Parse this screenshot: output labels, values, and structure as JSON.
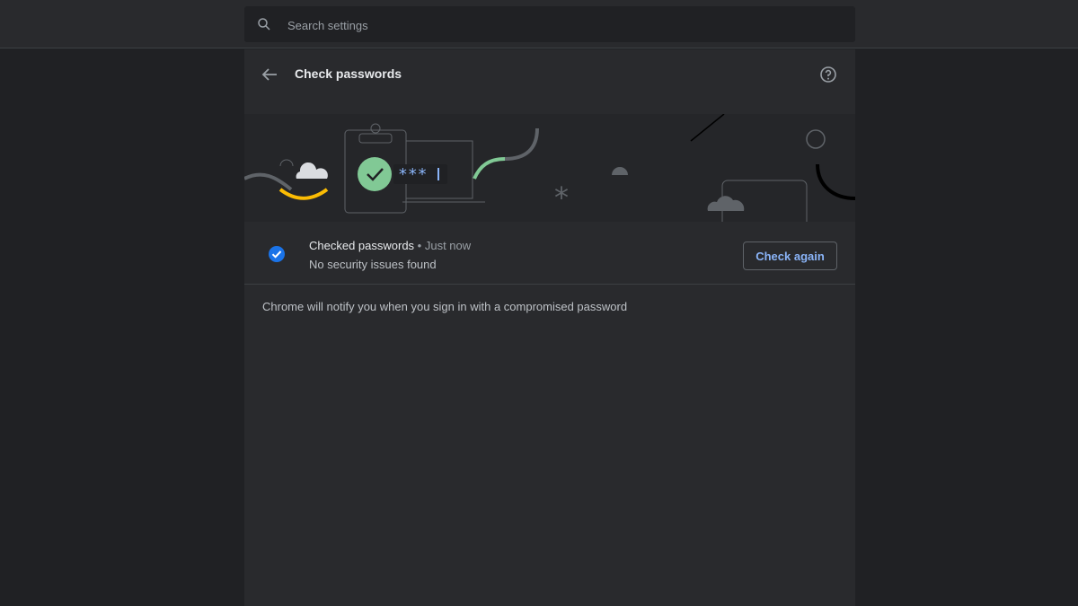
{
  "search": {
    "placeholder": "Search settings",
    "icon": "search-icon"
  },
  "header": {
    "title": "Check passwords",
    "back_icon": "arrow-back-icon",
    "help_icon": "help-icon"
  },
  "status": {
    "title": "Checked passwords",
    "separator": " • ",
    "time": "Just now",
    "detail": "No security issues found",
    "icon": "check-circle-icon",
    "button_label": "Check again"
  },
  "note": "Chrome will notify you when you sign in with a compromised password",
  "colors": {
    "background": "#202124",
    "card": "#292a2d",
    "accent": "#8ab4f8",
    "check_blue": "#1a73e8",
    "illustration_green": "#81c995",
    "illustration_yellow": "#fbbc04"
  }
}
